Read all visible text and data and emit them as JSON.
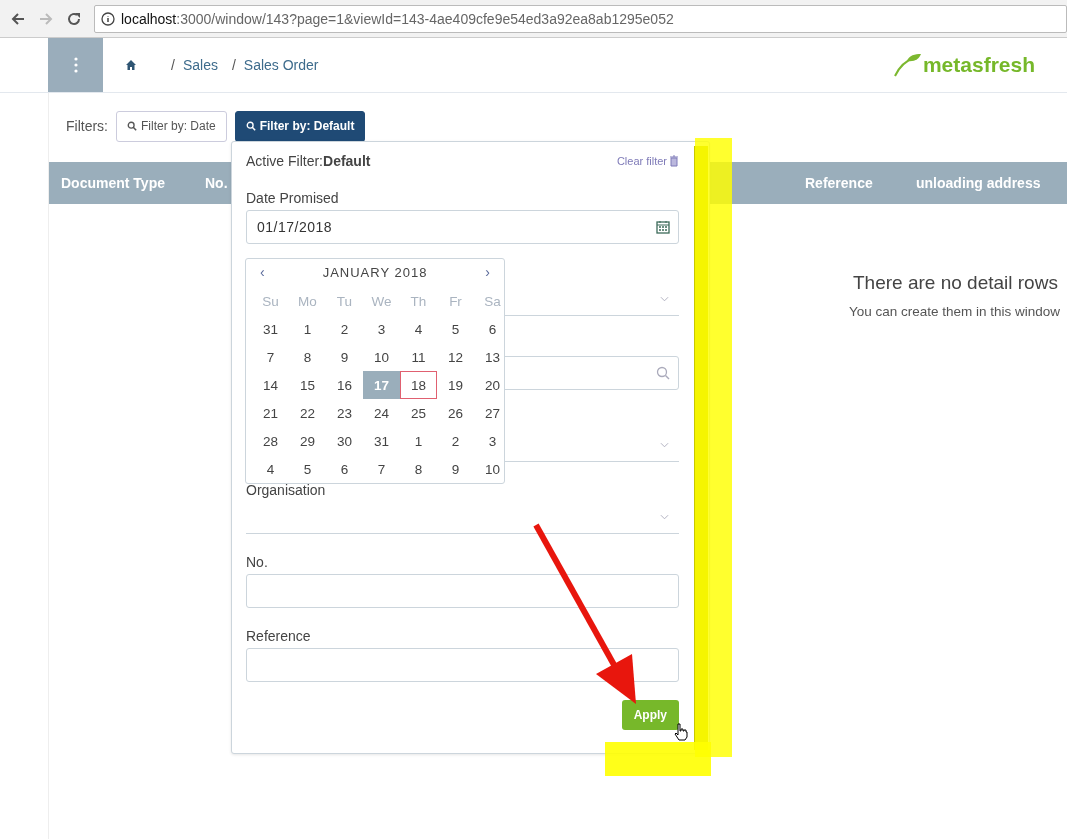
{
  "browser": {
    "url_host": "localhost",
    "url_rest": ":3000/window/143?page=1&viewId=143-4ae409cfe9e54ed3a92ea8ab1295e052"
  },
  "breadcrumb": [
    {
      "separator": "/",
      "label": "Sales"
    },
    {
      "separator": "/",
      "label": "Sales Order"
    }
  ],
  "logo": "metasfresh",
  "filters": {
    "label": "Filters:",
    "buttons": [
      {
        "label": "Filter by: Date",
        "selected": false
      },
      {
        "label": "Filter by: Default",
        "selected": true
      }
    ]
  },
  "table": {
    "columns": [
      "Document Type",
      "No.",
      "Reference",
      "unloading address"
    ]
  },
  "empty_state": {
    "title": "There are no detail rows",
    "text": "You can create them in this window"
  },
  "filter_panel": {
    "active_label": "Active Filter:",
    "active_name": "Default",
    "clear": "Clear filter",
    "fields": [
      {
        "kind": "date",
        "label": "Date Promised",
        "value": "01/17/2018"
      },
      {
        "kind": "dropdown"
      },
      {
        "kind": "search"
      },
      {
        "kind": "dropdown"
      },
      {
        "kind": "dropdown",
        "label": "Organisation"
      },
      {
        "kind": "text",
        "label": "No."
      },
      {
        "kind": "text",
        "label": "Reference"
      }
    ],
    "apply": "Apply"
  },
  "calendar": {
    "prev": "‹",
    "next": "›",
    "month": "JANUARY 2018",
    "weekdays": [
      "Su",
      "Mo",
      "Tu",
      "We",
      "Th",
      "Fr",
      "Sa"
    ],
    "weeks": [
      [
        {
          "day": "31",
          "selected": false,
          "today": false
        },
        {
          "day": "1",
          "selected": false,
          "today": false
        },
        {
          "day": "2",
          "selected": false,
          "today": false
        },
        {
          "day": "3",
          "selected": false,
          "today": false
        },
        {
          "day": "4",
          "selected": false,
          "today": false
        },
        {
          "day": "5",
          "selected": false,
          "today": false
        },
        {
          "day": "6",
          "selected": false,
          "today": false
        }
      ],
      [
        {
          "day": "7",
          "selected": false,
          "today": false
        },
        {
          "day": "8",
          "selected": false,
          "today": false
        },
        {
          "day": "9",
          "selected": false,
          "today": false
        },
        {
          "day": "10",
          "selected": false,
          "today": false
        },
        {
          "day": "11",
          "selected": false,
          "today": false
        },
        {
          "day": "12",
          "selected": false,
          "today": false
        },
        {
          "day": "13",
          "selected": false,
          "today": false
        }
      ],
      [
        {
          "day": "14",
          "selected": false,
          "today": false
        },
        {
          "day": "15",
          "selected": false,
          "today": false
        },
        {
          "day": "16",
          "selected": false,
          "today": false
        },
        {
          "day": "17",
          "selected": true,
          "today": false
        },
        {
          "day": "18",
          "selected": false,
          "today": true
        },
        {
          "day": "19",
          "selected": false,
          "today": false
        },
        {
          "day": "20",
          "selected": false,
          "today": false
        }
      ],
      [
        {
          "day": "21",
          "selected": false,
          "today": false
        },
        {
          "day": "22",
          "selected": false,
          "today": false
        },
        {
          "day": "23",
          "selected": false,
          "today": false
        },
        {
          "day": "24",
          "selected": false,
          "today": false
        },
        {
          "day": "25",
          "selected": false,
          "today": false
        },
        {
          "day": "26",
          "selected": false,
          "today": false
        },
        {
          "day": "27",
          "selected": false,
          "today": false
        }
      ],
      [
        {
          "day": "28",
          "selected": false,
          "today": false
        },
        {
          "day": "29",
          "selected": false,
          "today": false
        },
        {
          "day": "30",
          "selected": false,
          "today": false
        },
        {
          "day": "31",
          "selected": false,
          "today": false
        },
        {
          "day": "1",
          "selected": false,
          "today": false
        },
        {
          "day": "2",
          "selected": false,
          "today": false
        },
        {
          "day": "3",
          "selected": false,
          "today": false
        }
      ],
      [
        {
          "day": "4",
          "selected": false,
          "today": false
        },
        {
          "day": "5",
          "selected": false,
          "today": false
        },
        {
          "day": "6",
          "selected": false,
          "today": false
        },
        {
          "day": "7",
          "selected": false,
          "today": false
        },
        {
          "day": "8",
          "selected": false,
          "today": false
        },
        {
          "day": "9",
          "selected": false,
          "today": false
        },
        {
          "day": "10",
          "selected": false,
          "today": false
        }
      ]
    ]
  }
}
